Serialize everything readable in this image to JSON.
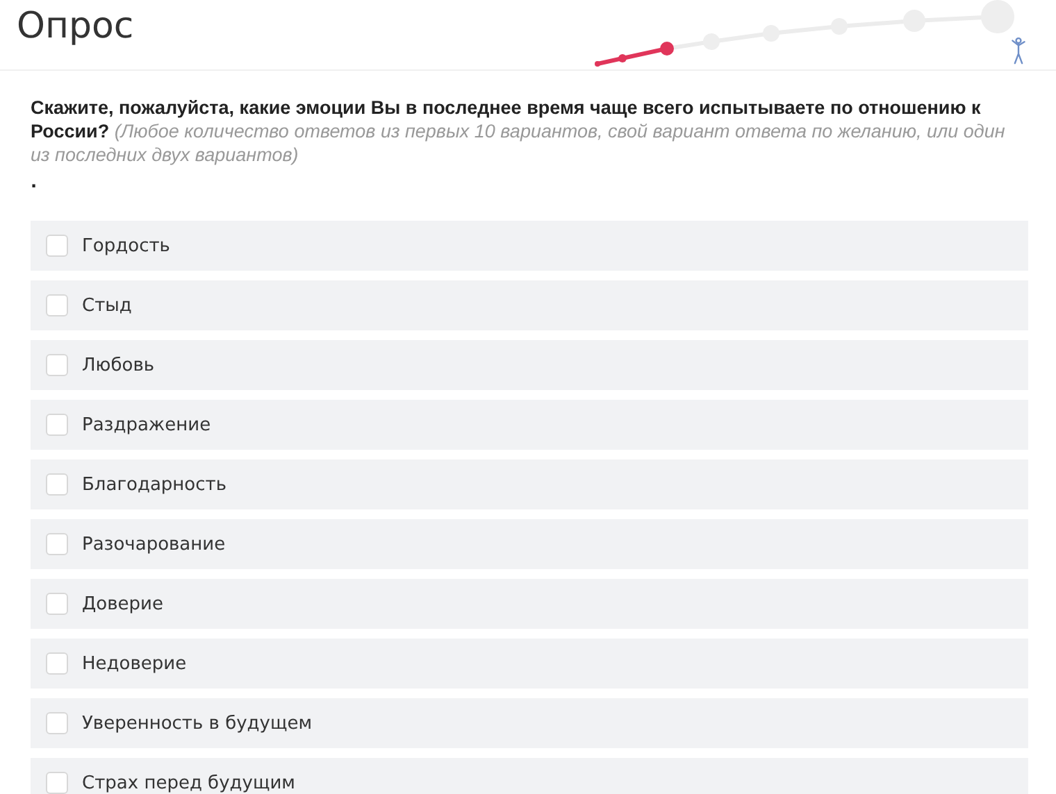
{
  "title": "Опрос",
  "question": {
    "text": "**Скажите, пожалуйста, какие эмоции Вы в последнее время чаще всего испытываете по отношению к России?** *(Любое количество ответов из первых 10 вариантов, свой вариант ответа по желанию, или один из последних двух вариантов)*",
    "note": "."
  },
  "options": [
    {
      "label": "Гордость",
      "checked": false
    },
    {
      "label": "Стыд",
      "checked": false
    },
    {
      "label": "Любовь",
      "checked": false
    },
    {
      "label": "Раздражение",
      "checked": false
    },
    {
      "label": "Благодарность",
      "checked": false
    },
    {
      "label": "Разочарование",
      "checked": false
    },
    {
      "label": "Доверие",
      "checked": false
    },
    {
      "label": "Недоверие",
      "checked": false
    },
    {
      "label": "Уверенность в будущем",
      "checked": false
    },
    {
      "label": "Страх перед будущим",
      "checked": false
    }
  ]
}
